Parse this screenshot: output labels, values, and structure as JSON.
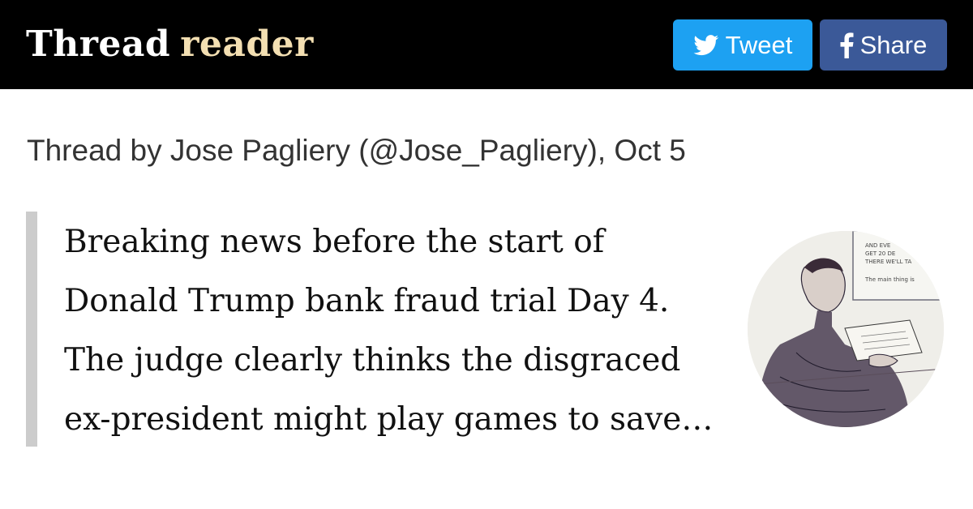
{
  "header": {
    "logo_word1": "Thread",
    "logo_word2": "reader",
    "tweet_label": "Tweet",
    "share_label": "Share",
    "tweet_icon": "twitter-bird-icon",
    "share_icon": "facebook-f-icon",
    "colors": {
      "bar": "#000000",
      "logo_accent": "#f3dfb2",
      "tweet_bg": "#1da1f2",
      "share_bg": "#3b5998"
    }
  },
  "thread": {
    "byline": "Thread by Jose Pagliery (@Jose_Pagliery), Oct 5",
    "text": "Breaking news before the start of\nDonald Trump bank fraud trial Day 4.\nThe judge clearly thinks the disgraced\nex-president might play games to save…"
  },
  "avatar": {
    "image": "courtroom-sketch",
    "sketch_text": [
      "AND EVE",
      "GET 20 DE",
      "THERE WE'LL TA",
      "The main thing is"
    ]
  }
}
